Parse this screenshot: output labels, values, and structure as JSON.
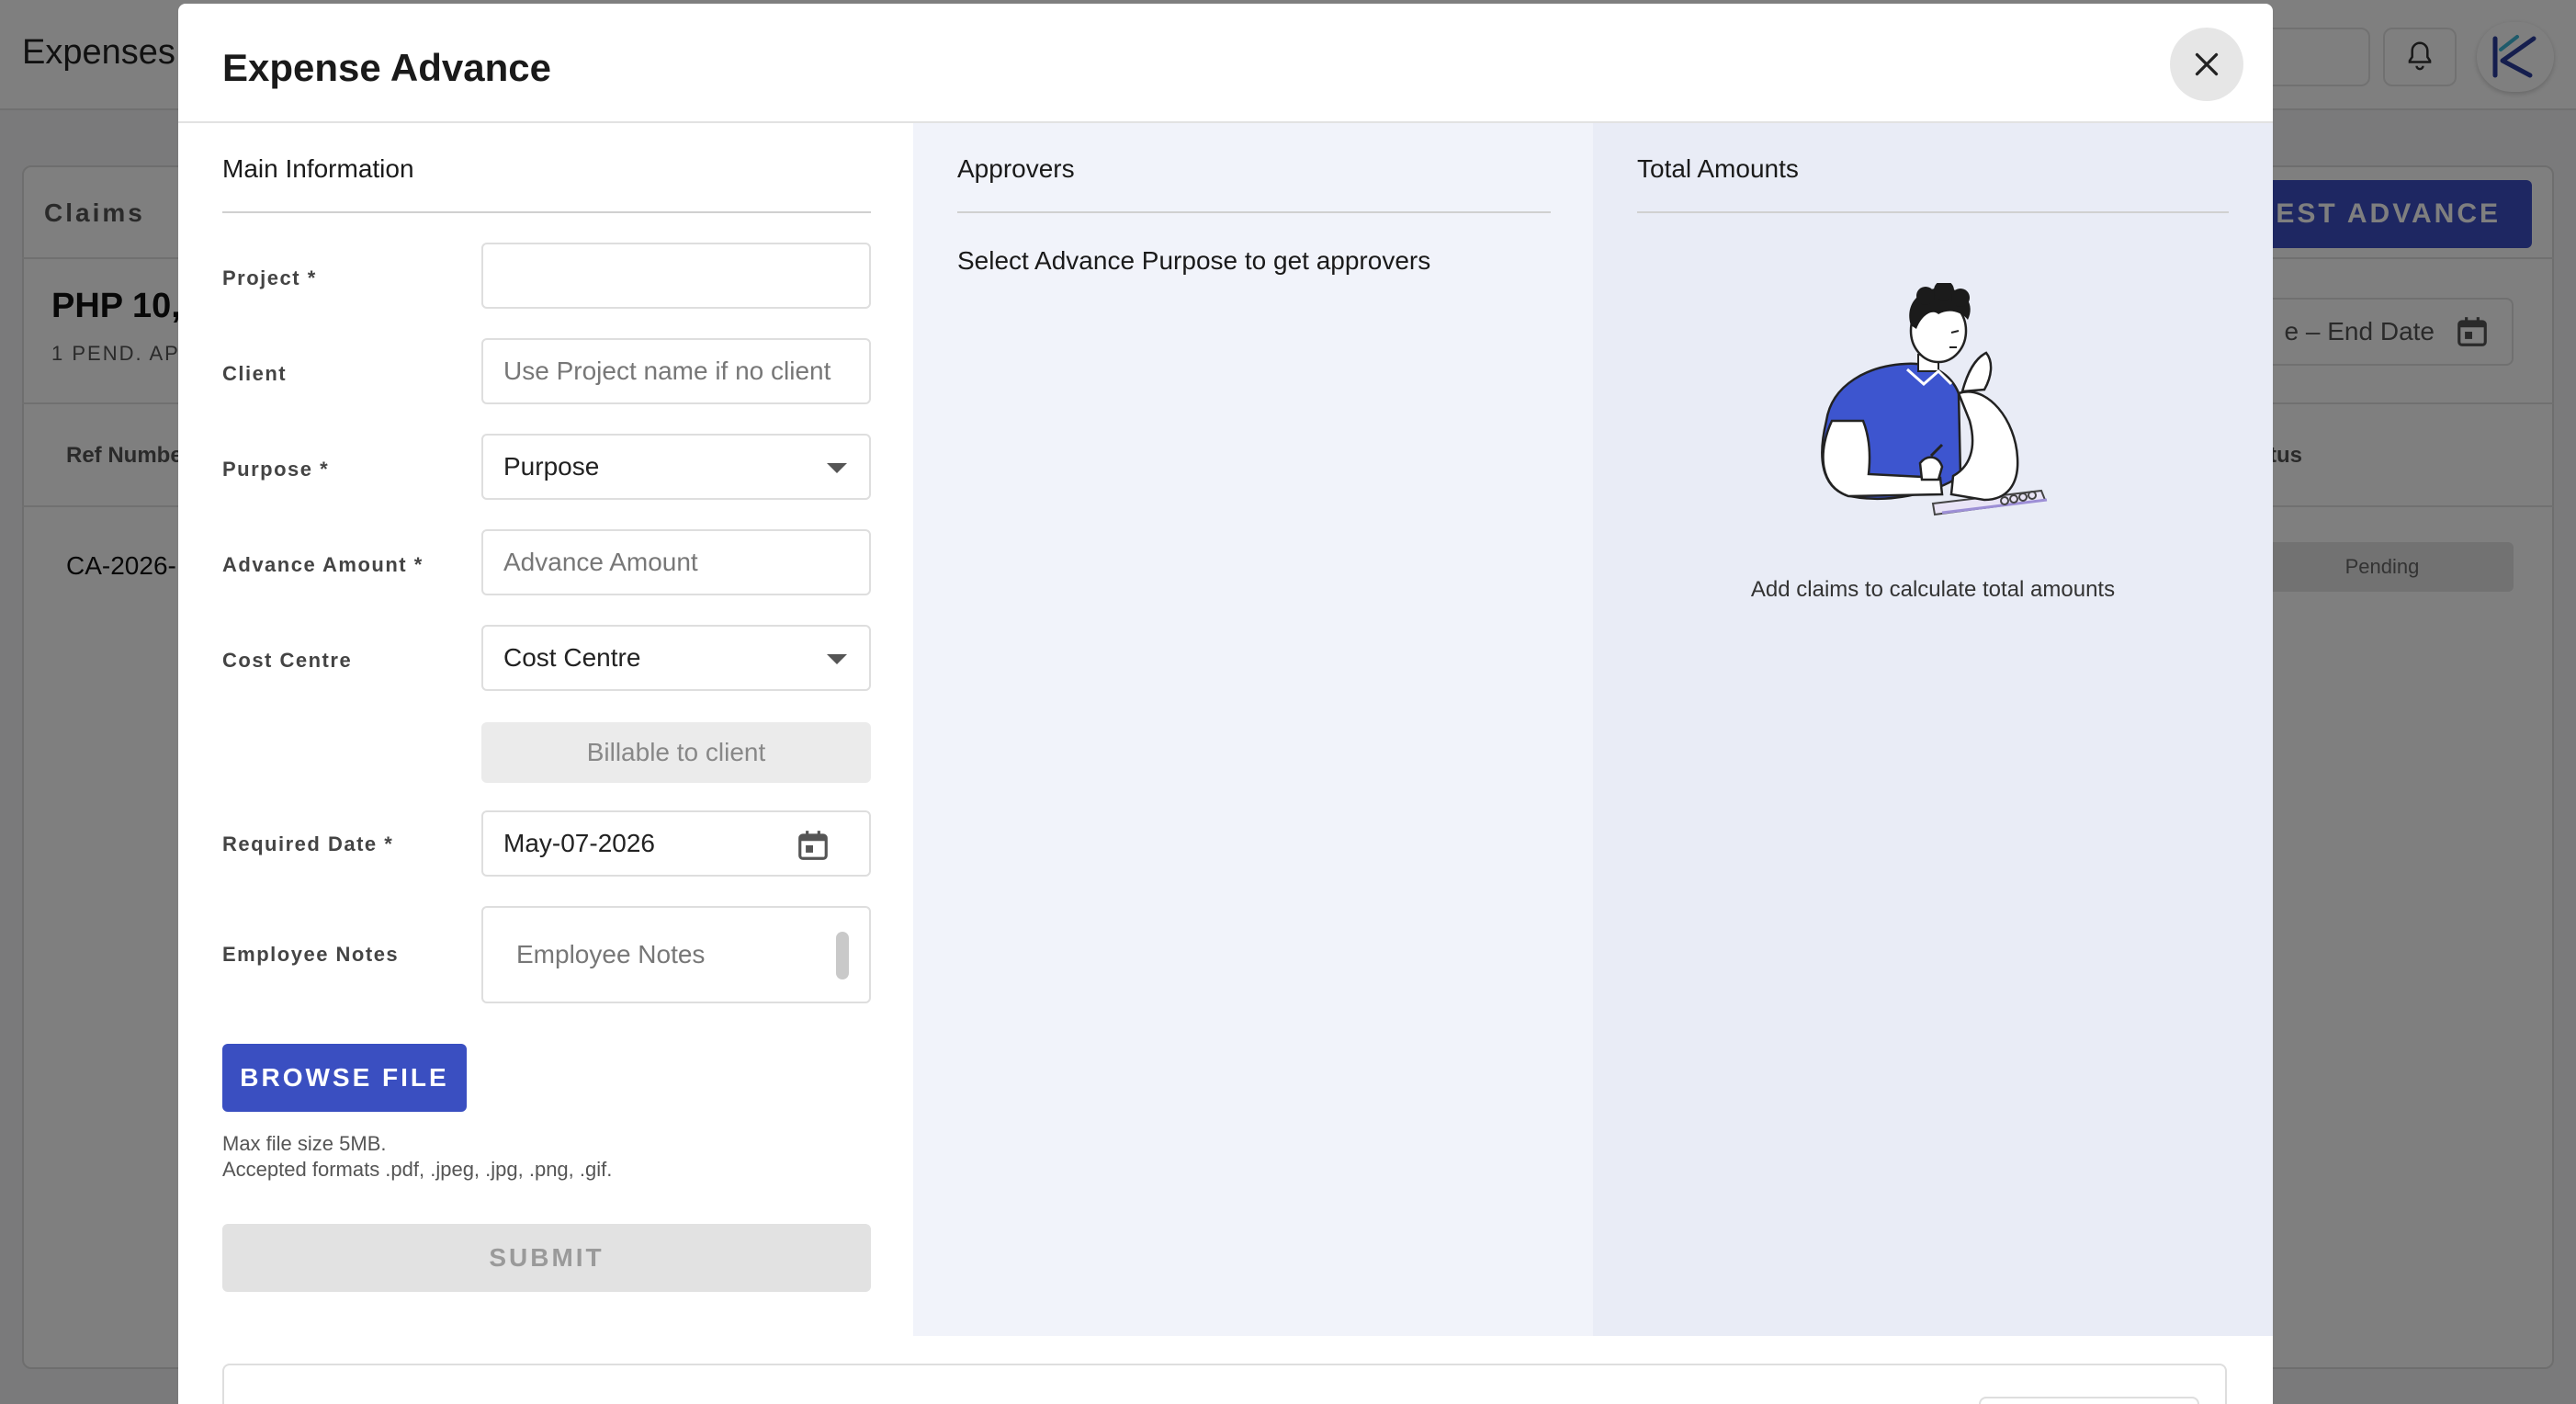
{
  "app": {
    "title": "Expenses",
    "tab_claims": "Claims",
    "total_amount": "PHP 10,",
    "pending_label": "1  PEND. AP",
    "table": {
      "ref_header": "Ref Numbe",
      "status_header": "tus",
      "rows": [
        {
          "ref": "CA-2026-",
          "status": "Pending"
        }
      ]
    },
    "request_advance_label": "QUEST ADVANCE",
    "date_range_label": "e – End Date",
    "icons": {
      "bell": "bell-icon",
      "logo": "brand-logo-icon",
      "calendar": "calendar-icon"
    }
  },
  "modal": {
    "title": "Expense Advance",
    "close_icon": "close-icon",
    "main": {
      "section_title": "Main Information",
      "project": {
        "label": "Project",
        "required": "*",
        "value": ""
      },
      "client": {
        "label": "Client",
        "placeholder": "Use Project name if no client"
      },
      "purpose": {
        "label": "Purpose",
        "required": "*",
        "placeholder": "Purpose"
      },
      "advance_amount": {
        "label": "Advance Amount",
        "required": "*",
        "placeholder": "Advance Amount"
      },
      "cost_centre": {
        "label": "Cost Centre",
        "placeholder": "Cost Centre"
      },
      "billable_label": "Billable to client",
      "required_date": {
        "label": "Required Date",
        "required": "*",
        "value": "May-07-2026"
      },
      "employee_notes": {
        "label": "Employee Notes",
        "placeholder": "Employee Notes"
      },
      "browse_label": "BROWSE FILE",
      "file_note_1": "Max file size 5MB.",
      "file_note_2": "Accepted formats .pdf, .jpeg, .jpg, .png, .gif.",
      "submit_label": "SUBMIT"
    },
    "approvers": {
      "section_title": "Approvers",
      "hint": "Select Advance Purpose to get approvers"
    },
    "totals": {
      "section_title": "Total Amounts",
      "empty_text": "Add claims to calculate total amounts"
    }
  },
  "colors": {
    "primary": "#3a4fc1",
    "overlay": "rgba(0,0,0,0.5)",
    "approvers_bg": "#f1f3fa",
    "totals_bg": "#e9ecf6"
  }
}
